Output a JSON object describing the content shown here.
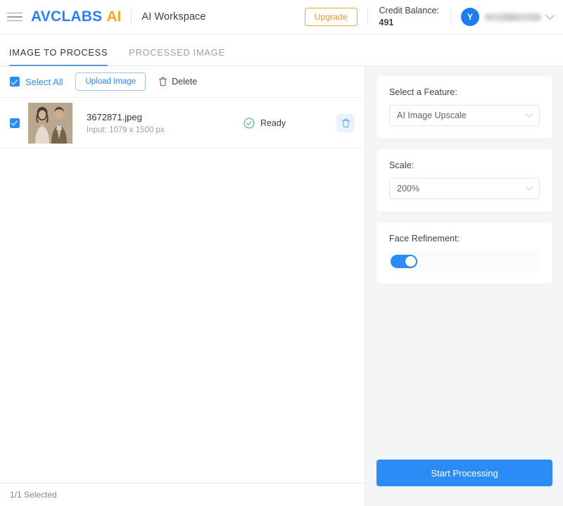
{
  "header": {
    "menu_icon": "hamburger-menu-icon",
    "brand_main": "AVCLABS",
    "brand_ai": "AI",
    "workspace_title": "AI Workspace",
    "upgrade_label": "Upgrade",
    "credit_label": "Credit Balance:",
    "credit_value": "491",
    "avatar_initial": "Y",
    "username": "",
    "account_chevron_icon": "chevron-down-icon"
  },
  "tabs": [
    {
      "label": "IMAGE TO PROCESS",
      "active": true
    },
    {
      "label": "PROCESSED IMAGE",
      "active": false
    }
  ],
  "toolbar": {
    "select_all_label": "Select All",
    "select_all_checked": true,
    "upload_label": "Upload Image",
    "delete_label": "Delete",
    "delete_icon": "trash-icon"
  },
  "files": [
    {
      "checked": true,
      "name": "3672871.jpeg",
      "input_info": "Input: 1079 x 1500 px",
      "status": "Ready",
      "status_icon": "check-circle-icon",
      "row_delete_icon": "trash-icon"
    }
  ],
  "status_bar": {
    "selected_text": "1/1 Selected"
  },
  "panels": {
    "feature": {
      "label": "Select a Feature:",
      "value": "AI Image Upscale",
      "chevron_icon": "chevron-down-icon"
    },
    "scale": {
      "label": "Scale:",
      "value": "200%",
      "chevron_icon": "chevron-down-icon"
    },
    "face_refinement": {
      "label": "Face Refinement:",
      "enabled": true
    }
  },
  "actions": {
    "start_label": "Start Processing"
  },
  "colors": {
    "brand_blue": "#2b82f6",
    "brand_orange": "#f5a623",
    "accent_blue": "#2b8cf5",
    "status_green": "#34a853",
    "panel_bg": "#f4f5f7"
  }
}
